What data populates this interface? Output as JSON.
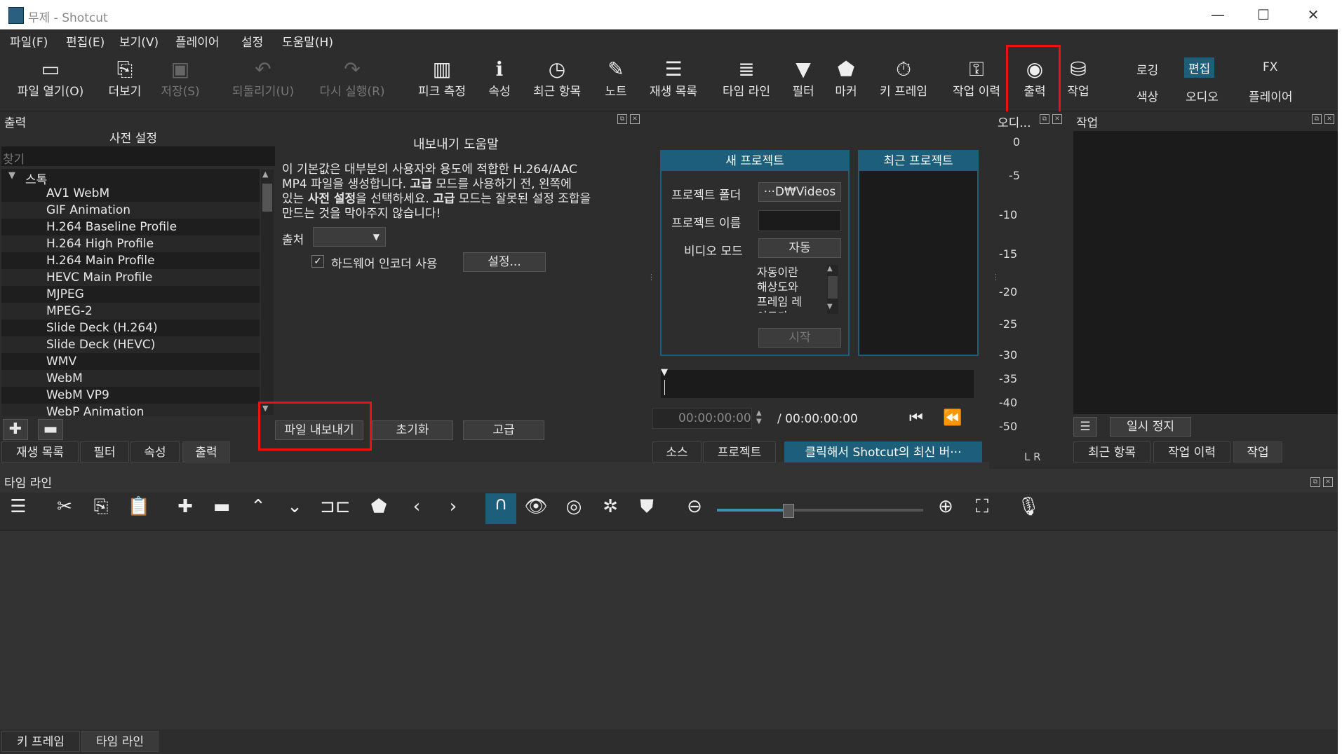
{
  "window": {
    "title": "무제 - Shotcut"
  },
  "menu": [
    "파일(F)",
    "편집(E)",
    "보기(V)",
    "플레이어",
    "설정",
    "도움말(H)"
  ],
  "toolbar": {
    "open": "파일 열기(O)",
    "more": "더보기",
    "save": "저장(S)",
    "undo": "되돌리기(U)",
    "redo": "다시 실행(R)",
    "peak": "피크 측정",
    "props": "속성",
    "recent": "최근 항목",
    "notes": "노트",
    "playlist": "재생 목록",
    "timeline": "타임 라인",
    "filters": "필터",
    "markers": "마커",
    "keyframes": "키 프레임",
    "jobs": "작업 이력",
    "export": "출력",
    "tasks": "작업"
  },
  "workspaces": {
    "logging": "로깅",
    "editing": "편집",
    "fx": "FX",
    "color": "색상",
    "audio": "오디오",
    "player": "플레이어"
  },
  "export_panel": {
    "title": "출력",
    "presets_title": "사전 설정",
    "search_placeholder": "찾기",
    "stock": "스톡",
    "presets": [
      "AV1 WebM",
      "GIF Animation",
      "H.264 Baseline Profile",
      "H.264 High Profile",
      "H.264 Main Profile",
      "HEVC Main Profile",
      "MJPEG",
      "MPEG-2",
      "Slide Deck (H.264)",
      "Slide Deck (HEVC)",
      "WMV",
      "WebM",
      "WebM VP9",
      "WebP Animation"
    ],
    "help_title": "내보내기 도움말",
    "help_text_1": "이 기본값은 대부분의 사용자와 용도에 적합한 H.264/AAC",
    "help_text_2_a": "MP4 파일을 생성합니다. ",
    "help_text_2_b": "고급",
    "help_text_2_c": " 모드를 사용하기 전, 왼쪽에",
    "help_text_3_a": "있는 ",
    "help_text_3_b": "사전 설정",
    "help_text_3_c": "을 선택하세요. ",
    "help_text_3_d": "고급",
    "help_text_3_e": " 모드는 잘못된 설정 조합을",
    "help_text_4": "만드는 것을 막아주지 않습니다!",
    "source_label": "출처",
    "hw_encoder": "하드웨어 인코더 사용",
    "settings_btn": "설정...",
    "export_file": "파일 내보내기",
    "reset": "초기화",
    "advanced": "고급"
  },
  "left_tabs": [
    "재생 목록",
    "필터",
    "속성",
    "출력"
  ],
  "project": {
    "new_title": "새 프로젝트",
    "recent_title": "최근 프로젝트",
    "folder_label": "프로젝트 폴더",
    "folder_value": "···D₩Videos",
    "name_label": "프로젝트 이름",
    "video_mode_label": "비디오 모드",
    "video_mode_value": "자동",
    "auto_desc": "자동이란 해상도와 프레임 레이트가",
    "start": "시작"
  },
  "player": {
    "current_time": "00:00:00:00",
    "total_time": "/ 00:00:00:00"
  },
  "center_tabs": {
    "source": "소스",
    "project": "프로젝트",
    "update": "클릭해서 Shotcut의 최신 버···"
  },
  "audio": {
    "title": "오디...",
    "scale": [
      "0",
      "-5",
      "-10",
      "-15",
      "-20",
      "-25",
      "-30",
      "-35",
      "-40",
      "-50"
    ],
    "lr": "L R"
  },
  "jobs_panel": {
    "title": "작업",
    "pause": "일시 정지"
  },
  "right_tabs": [
    "최근 항목",
    "작업 이력",
    "작업"
  ],
  "timeline": {
    "title": "타임 라인"
  },
  "bottom_tabs": [
    "키 프레임",
    "타임 라인"
  ]
}
